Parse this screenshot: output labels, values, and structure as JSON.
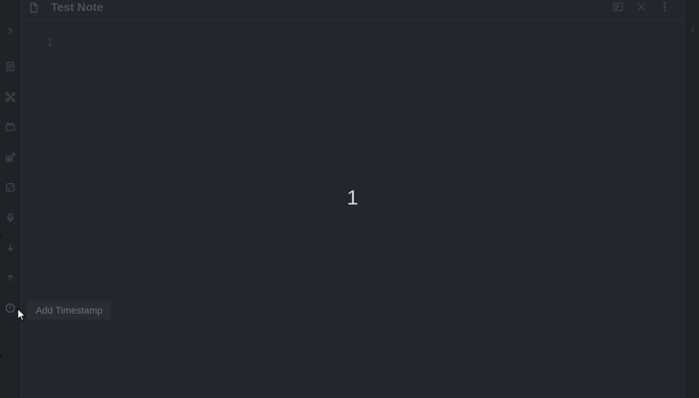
{
  "note": {
    "title": "Test Note",
    "line_number": "1",
    "content_counter": "1"
  },
  "ribbon": {
    "items": [
      {
        "icon": "chevron-right-icon"
      },
      {
        "icon": "document-list-icon"
      },
      {
        "icon": "graph-icon"
      },
      {
        "icon": "cards-icon"
      },
      {
        "icon": "grid-add-icon"
      },
      {
        "icon": "dice-icon"
      },
      {
        "icon": "microphone-icon"
      },
      {
        "icon": "arrow-down-icon"
      },
      {
        "icon": "arrow-up-icon"
      },
      {
        "icon": "clock-icon"
      }
    ]
  },
  "header": {
    "actions": [
      {
        "icon": "reading-view-icon"
      },
      {
        "icon": "close-icon"
      },
      {
        "icon": "more-options-icon"
      }
    ]
  },
  "tooltip": {
    "text": "Add Timestamp"
  },
  "colors": {
    "background": "#23262d",
    "ribbon": "#1f2227",
    "counter_text": "#d6d8dc",
    "tooltip_bg": "#2a2d33"
  }
}
